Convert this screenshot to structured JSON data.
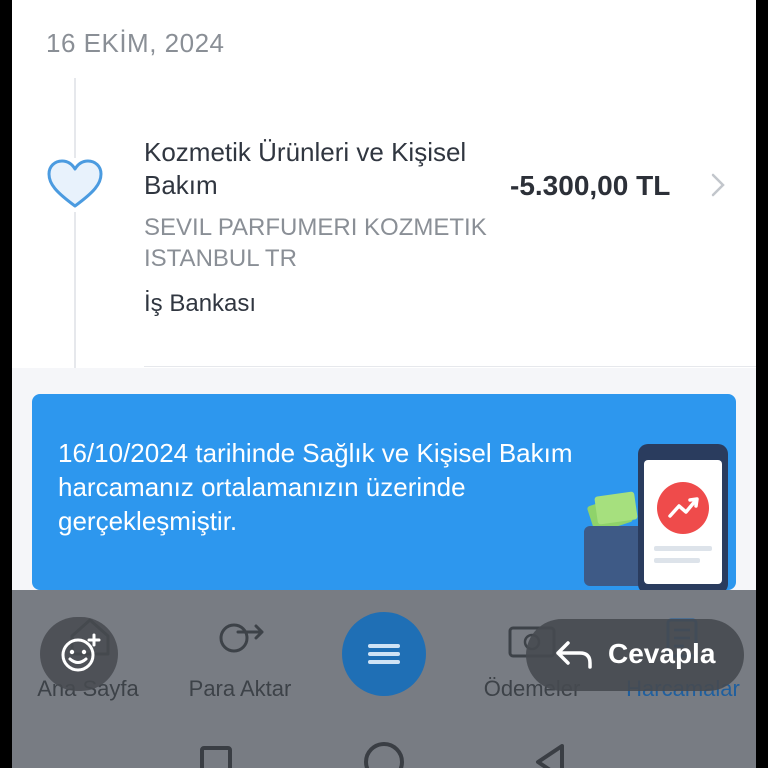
{
  "date_header": "16 EKİM, 2024",
  "transaction": {
    "title": "Kozmetik Ürünleri ve Kişisel Bakım",
    "amount": "-5.300,00 TL",
    "merchant": "SEVIL PARFUMERI KOZMETIK ISTANBUL TR",
    "bank": "İş Bankası",
    "icon": "heart-icon"
  },
  "banner": {
    "text": "16/10/2024 tarihinde Sağlık ve Kişisel Bakım harcamanız ortalamanızın üzerinde gerçekleşmiştir."
  },
  "bottom_nav": {
    "home": "Ana Sayfa",
    "transfer": "Para Aktar",
    "payments": "Ödemeler",
    "spending": "Harcamalar"
  },
  "reply": {
    "label": "Cevapla"
  },
  "colors": {
    "accent": "#2d97ee",
    "fab": "#1f6fb5",
    "heart": "#4b9be0",
    "illus_red": "#ef4b4b"
  }
}
